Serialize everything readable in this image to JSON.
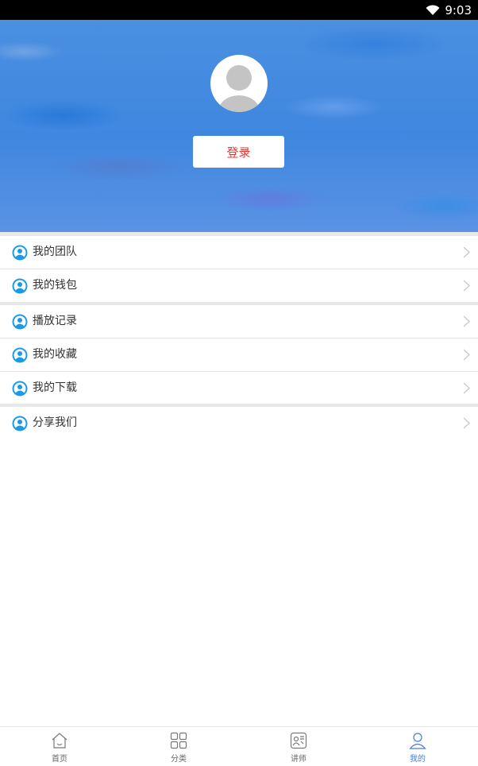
{
  "status_bar": {
    "time": "9:03",
    "wifi_icon": "wifi-icon"
  },
  "profile": {
    "avatar_icon": "default-avatar-icon",
    "login_label": "登录"
  },
  "menu": {
    "group1": [
      {
        "label": "我的团队",
        "icon": "user-circle-icon"
      },
      {
        "label": "我的钱包",
        "icon": "user-circle-icon"
      }
    ],
    "group2": [
      {
        "label": "播放记录",
        "icon": "user-circle-icon"
      },
      {
        "label": "我的收藏",
        "icon": "user-circle-icon"
      },
      {
        "label": "我的下载",
        "icon": "user-circle-icon"
      }
    ],
    "group3": [
      {
        "label": "分享我们",
        "icon": "user-circle-icon"
      }
    ]
  },
  "tabbar": {
    "tabs": [
      {
        "label": "首页",
        "icon": "home-icon"
      },
      {
        "label": "分类",
        "icon": "grid-icon"
      },
      {
        "label": "讲师",
        "icon": "teacher-icon"
      },
      {
        "label": "我的",
        "icon": "person-icon",
        "active": true
      }
    ],
    "active_color": "#4a7cd8",
    "inactive_color": "#666666"
  },
  "colors": {
    "header_blue": "#3f87e0",
    "login_text": "#e53935",
    "menu_icon": "#1a9be8"
  }
}
